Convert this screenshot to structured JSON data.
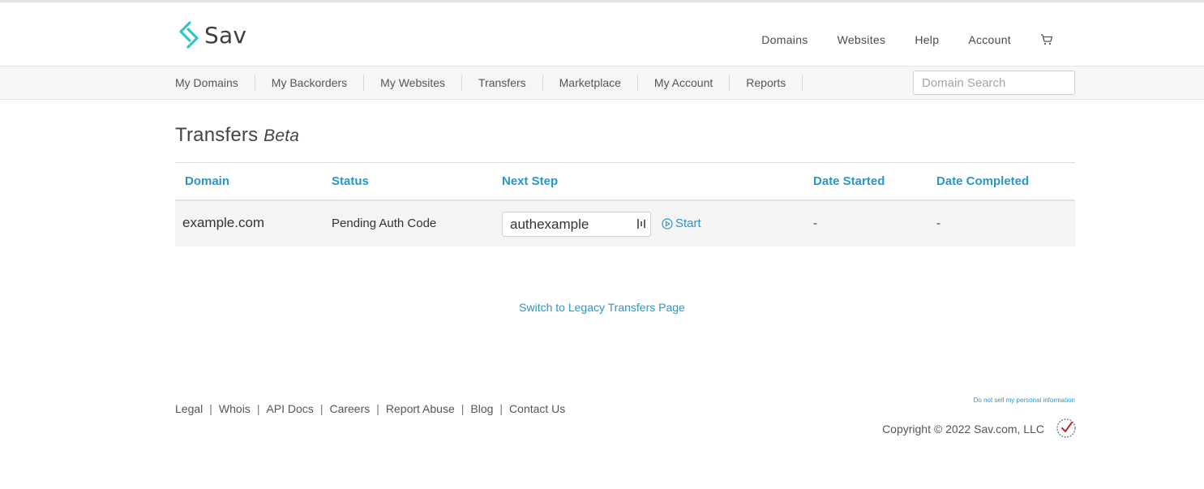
{
  "brand": {
    "name": "Sav",
    "accent": "#2a96c8",
    "logo_color": "#2fc7c0"
  },
  "topnav": {
    "items": [
      "Domains",
      "Websites",
      "Help",
      "Account"
    ],
    "cart_icon": "shopping-cart-icon"
  },
  "subnav": {
    "items": [
      "My Domains",
      "My Backorders",
      "My Websites",
      "Transfers",
      "Marketplace",
      "My Account",
      "Reports"
    ],
    "search_placeholder": "Domain Search"
  },
  "page": {
    "title": "Transfers",
    "title_suffix": "Beta"
  },
  "table": {
    "headers": [
      "Domain",
      "Status",
      "Next Step",
      "Date Started",
      "Date Completed"
    ],
    "rows": [
      {
        "domain": "example.com",
        "status": "Pending Auth Code",
        "auth_code": "authexample",
        "action": "Start",
        "date_started": "-",
        "date_completed": "-"
      }
    ]
  },
  "legacy_link": "Switch to Legacy Transfers Page",
  "footer": {
    "links": [
      "Legal",
      "Whois",
      "API Docs",
      "Careers",
      "Report Abuse",
      "Blog",
      "Contact Us"
    ],
    "separator": "|",
    "do_not_sell": "Do not sell my personal information",
    "copyright": "Copyright © 2022 Sav.com, LLC"
  }
}
